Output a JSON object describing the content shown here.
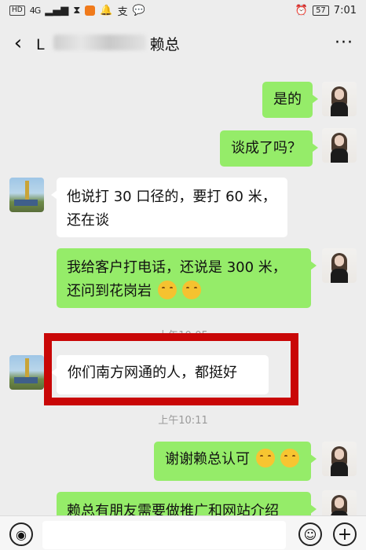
{
  "status_bar": {
    "hd": "HD",
    "network": "4G",
    "battery": "57",
    "time": "7:01"
  },
  "header": {
    "back_icon": "chevron-left-icon",
    "title_prefix": "L",
    "title_suffix": "赖总",
    "more_icon": "more-dots-icon",
    "more_glyph": "···"
  },
  "messages": [
    {
      "side": "me",
      "text": "是的"
    },
    {
      "side": "me",
      "text": "谈成了吗？"
    },
    {
      "side": "them",
      "lines": [
        "他说打 30 口径的，要打 60 米，",
        "还在谈"
      ]
    },
    {
      "side": "me",
      "lines": [
        "我给客户打电话，还说是 300 米，",
        "还问到花岗岩"
      ]
    },
    {
      "side": "them",
      "text": "你们南方网通的人，都挺好"
    },
    {
      "side": "me",
      "text": "谢谢赖总认可"
    },
    {
      "side": "me",
      "text": "赖总有朋友需要做推广和网站介绍"
    }
  ],
  "timestamps": {
    "t1": "上午10:05",
    "t2": "上午10:11"
  },
  "colors": {
    "my_bubble": "#95ec69",
    "their_bubble": "#ffffff",
    "highlight_box": "#c90707",
    "background": "#ededed"
  },
  "input_bar": {
    "voice_icon": "voice-icon",
    "emoji_icon": "emoji-icon",
    "plus_icon": "plus-icon"
  }
}
